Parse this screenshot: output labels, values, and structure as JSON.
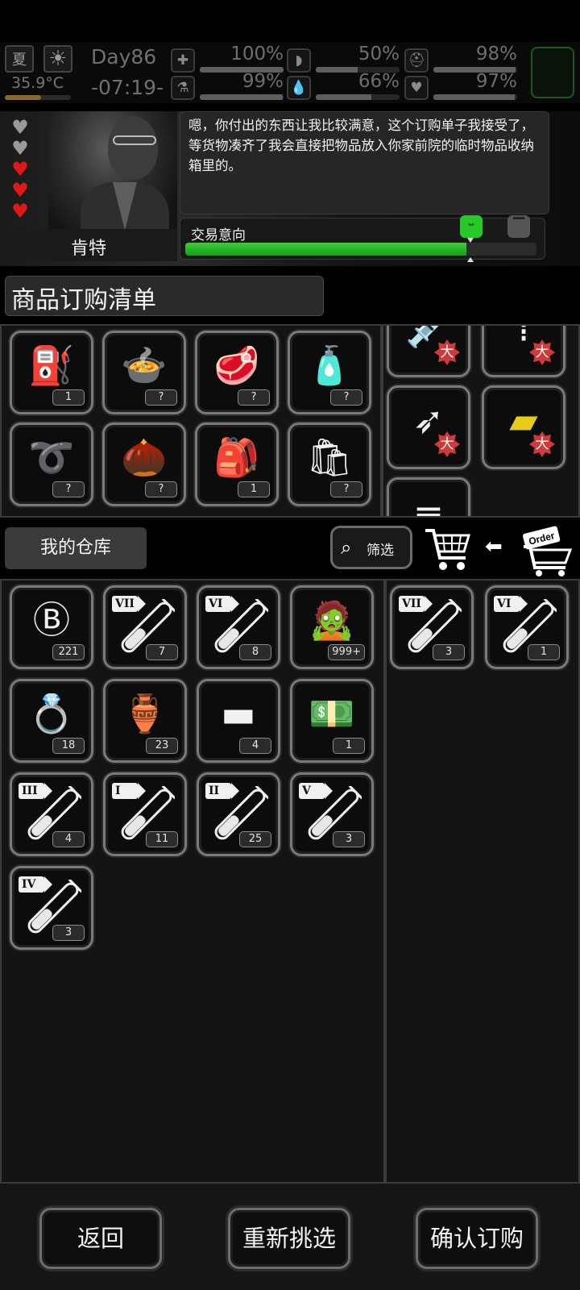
{
  "status": {
    "season": "夏",
    "weather_icon": "sun-icon",
    "temperature": "35.9°C",
    "temperature_level": 0.55,
    "day": "Day86",
    "time": "-07:19-",
    "stats": [
      {
        "name": "health",
        "icon": "medkit-icon",
        "glyph": "✚",
        "value": "100%",
        "level": 1.0
      },
      {
        "name": "hunger",
        "icon": "stomach-icon",
        "glyph": "◗",
        "value": "50%",
        "level": 0.5
      },
      {
        "name": "armor",
        "icon": "helmet-icon",
        "glyph": "⛑",
        "value": "98%",
        "level": 0.98
      },
      {
        "name": "sanity",
        "icon": "flask-icon",
        "glyph": "⚗",
        "value": "99%",
        "level": 0.99
      },
      {
        "name": "thirst",
        "icon": "water-drop-icon",
        "glyph": "💧",
        "value": "66%",
        "level": 0.66
      },
      {
        "name": "mood",
        "icon": "heart-icon",
        "glyph": "♥",
        "value": "97%",
        "level": 0.97
      }
    ]
  },
  "npc": {
    "name": "肯特",
    "hearts": [
      "gray",
      "gray",
      "red",
      "red",
      "red"
    ],
    "dialog": "嗯，你付出的东西让我比较满意，这个订购单子我接受了，等货物凑齐了我会直接把物品放入你家前院的临时物品收纳箱里的。",
    "trade_label": "交易意向",
    "trade_level": 0.8
  },
  "order_title": "商品订购清单",
  "order_items": [
    {
      "name": "fuel-can",
      "glyph": "⛽",
      "count": "1"
    },
    {
      "name": "pot",
      "glyph": "🍲",
      "count": "?"
    },
    {
      "name": "meat",
      "glyph": "🥩",
      "count": "?"
    },
    {
      "name": "water-bottle",
      "glyph": "🧴",
      "count": "?"
    },
    {
      "name": "rope",
      "glyph": "➰",
      "count": "?"
    },
    {
      "name": "seeds",
      "glyph": "🌰",
      "count": "?"
    },
    {
      "name": "backpack",
      "glyph": "🎒",
      "count": "1"
    },
    {
      "name": "groceries-bag",
      "glyph": "🛍",
      "count": "?"
    }
  ],
  "order_side_items": [
    {
      "name": "syringe",
      "glyph": "💉",
      "badge": "大"
    },
    {
      "name": "ammo",
      "glyph": "⁞",
      "badge": "大"
    },
    {
      "name": "bullets",
      "glyph": "➶",
      "badge": "大"
    },
    {
      "name": "gold-plate",
      "glyph": "▰",
      "badge": "大"
    },
    {
      "name": "partial-item",
      "glyph": "═"
    }
  ],
  "warehouse_title": "我的仓库",
  "filter_label": "筛选",
  "warehouse_items": [
    {
      "name": "casino-chip",
      "glyph": "Ⓑ",
      "count": "221"
    },
    {
      "name": "potion-vii",
      "roman": "VII",
      "fill": 0.45,
      "count": "7"
    },
    {
      "name": "potion-vi",
      "roman": "VI",
      "fill": 0.45,
      "count": "8"
    },
    {
      "name": "zombie-card",
      "glyph": "🧟",
      "count": "999+"
    },
    {
      "name": "diamond-ring",
      "glyph": "💍",
      "count": "18"
    },
    {
      "name": "vase",
      "glyph": "🏺",
      "count": "23"
    },
    {
      "name": "gold-bars",
      "glyph": "▬",
      "count": "4"
    },
    {
      "name": "cash-stack",
      "glyph": "💵",
      "count": "1"
    },
    {
      "name": "potion-iii",
      "roman": "III",
      "fill": 0.45,
      "count": "4"
    },
    {
      "name": "potion-i",
      "roman": "I",
      "fill": 0.45,
      "count": "11"
    },
    {
      "name": "potion-ii",
      "roman": "II",
      "fill": 0.45,
      "count": "25"
    },
    {
      "name": "potion-v",
      "roman": "V",
      "fill": 0.45,
      "count": "3"
    },
    {
      "name": "potion-iv",
      "roman": "IV",
      "fill": 0.45,
      "count": "3"
    }
  ],
  "offer_items": [
    {
      "name": "potion-vii",
      "roman": "VII",
      "fill": 0.45,
      "count": "3"
    },
    {
      "name": "potion-vi",
      "roman": "VI",
      "fill": 0.45,
      "count": "1"
    }
  ],
  "buttons": {
    "back": "返回",
    "reselect": "重新挑选",
    "confirm": "确认订购"
  },
  "colors": {
    "trade_green": "#22b822",
    "heart_red": "#e01818",
    "badge_red": "#cf3b3b",
    "gold": "#e8cc1a"
  }
}
